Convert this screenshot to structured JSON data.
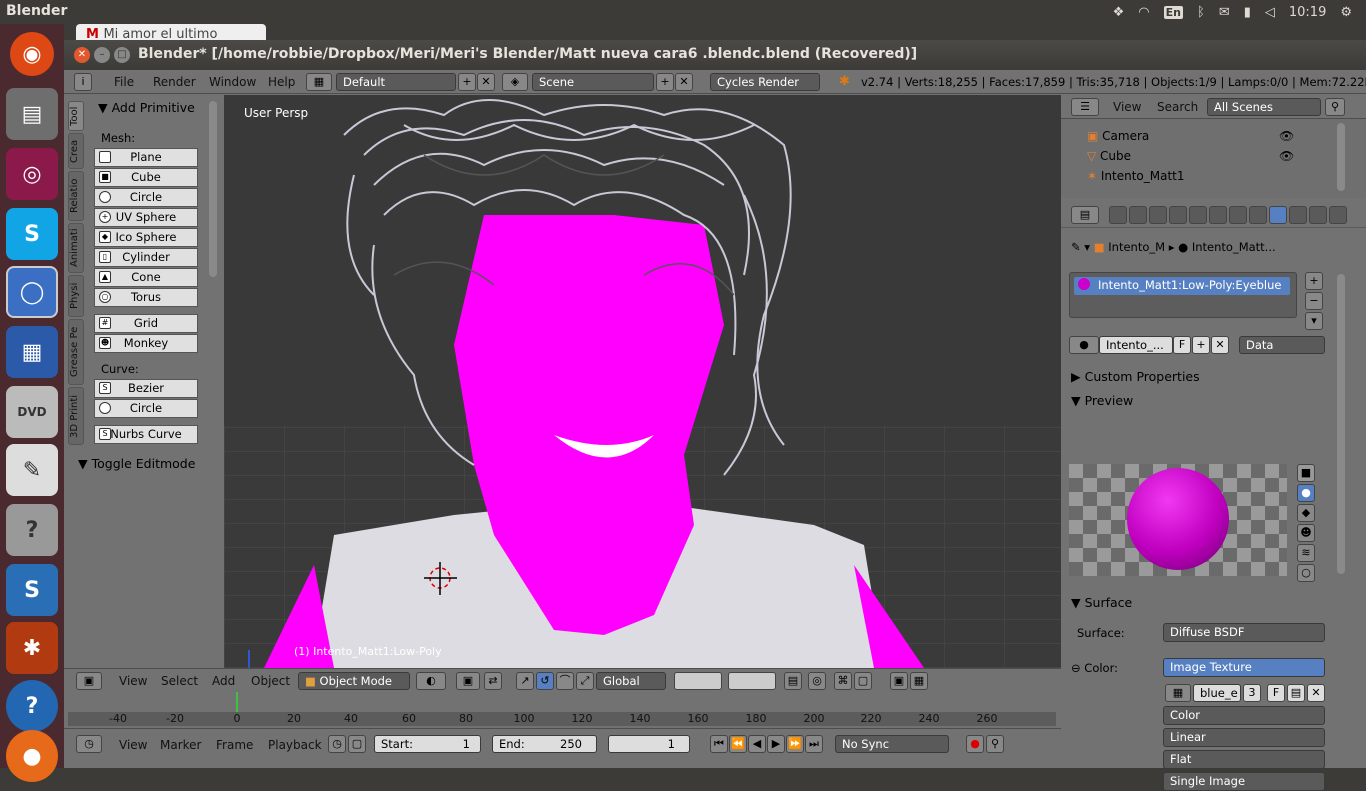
{
  "system": {
    "app_name": "Blender",
    "keyboard": "En",
    "clock": "10:19"
  },
  "browser_tab": "Mi amor el ultimo",
  "window": {
    "title": "Blender* [/home/robbie/Dropbox/Meri/Meri's Blender/Matt nueva cara6 .blendc.blend (Recovered)]"
  },
  "menubar": {
    "items": [
      "File",
      "Render",
      "Window",
      "Help"
    ],
    "screen_layout": "Default",
    "scene": "Scene",
    "render_engine": "Cycles Render",
    "stats": "v2.74 | Verts:18,255 | Faces:17,859 | Tris:35,718 | Objects:1/9 | Lamps:0/0 | Mem:72.22M | Int"
  },
  "toolshelf": {
    "tabs": [
      "Tool",
      "Crea",
      "Relatio",
      "Animati",
      "Physi",
      "Grease Pe",
      "3D Printi"
    ],
    "panel_title": "Add Primitive",
    "mesh_label": "Mesh:",
    "mesh_items": [
      "Plane",
      "Cube",
      "Circle",
      "UV Sphere",
      "Ico Sphere",
      "Cylinder",
      "Cone",
      "Torus"
    ],
    "other_items": [
      "Grid",
      "Monkey"
    ],
    "curve_label": "Curve:",
    "curve_items": [
      "Bezier",
      "Circle"
    ],
    "nurbs": "Nurbs Curve",
    "toggle_edit": "Toggle Editmode"
  },
  "viewport": {
    "label": "User Persp",
    "object_label": "(1) Intento_Matt1:Low-Poly"
  },
  "viewport_header": {
    "menus": [
      "View",
      "Select",
      "Add",
      "Object"
    ],
    "mode": "Object Mode",
    "orientation": "Global"
  },
  "timeline": {
    "ticks": [
      "-40",
      "-20",
      "0",
      "20",
      "40",
      "60",
      "80",
      "100",
      "120",
      "140",
      "160",
      "180",
      "200",
      "220",
      "240",
      "260"
    ],
    "menus": [
      "View",
      "Marker",
      "Frame",
      "Playback"
    ],
    "start_label": "Start:",
    "start_value": "1",
    "end_label": "End:",
    "end_value": "250",
    "current_frame": "1",
    "sync": "No Sync"
  },
  "outliner": {
    "menus": [
      "View",
      "Search"
    ],
    "filter": "All Scenes",
    "rows": [
      "Camera",
      "Cube",
      "Intento_Matt1"
    ]
  },
  "properties": {
    "breadcrumb_object": "Intento_M",
    "breadcrumb_material": "Intento_Matt...",
    "material_slot": "Intento_Matt1:Low-Poly:Eyeblue",
    "material_name": "Intento_...",
    "material_f": "F",
    "link": "Data",
    "custom_properties": "Custom Properties",
    "preview": "Preview",
    "surface_section": "Surface",
    "surface_label": "Surface:",
    "surface_value": "Diffuse BSDF",
    "color_label": "Color:",
    "color_value": "Image Texture",
    "image_name": "blue_e",
    "image_users": "3",
    "image_f": "F",
    "dropdowns": [
      "Color",
      "Linear",
      "Flat",
      "Single Image"
    ]
  },
  "colors": {
    "skin": "#ff00ff",
    "selected": "#5680c2"
  }
}
